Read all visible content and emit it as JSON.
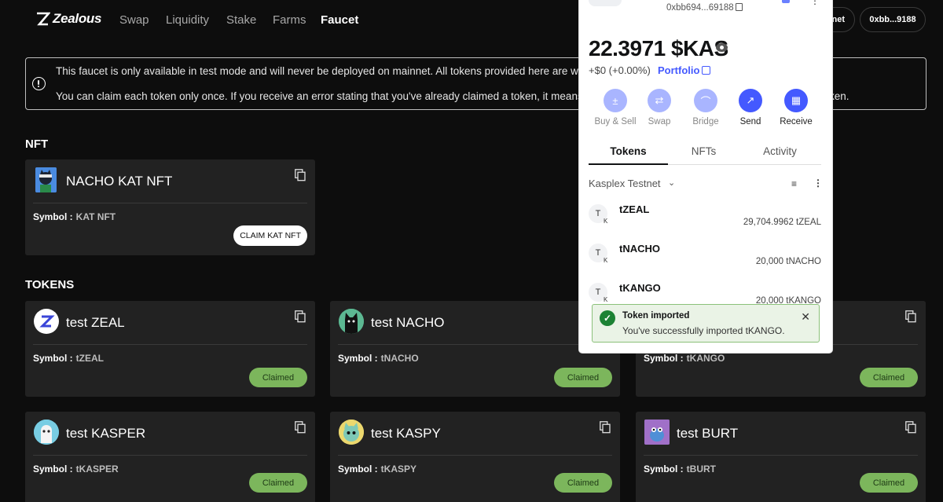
{
  "nav": {
    "brand": "Zealous",
    "links": [
      "Swap",
      "Liquidity",
      "Stake",
      "Farms",
      "Faucet"
    ],
    "active": "Faucet",
    "network_pill": "net",
    "account_pill": "0xbb...9188"
  },
  "banner": {
    "line1": "This faucet is only available in test mode and will never be deployed on mainnet. All tokens provided here are worthle",
    "line2_left": "You can claim each token only once. If you receive an error stating that you've already claimed a token, it means you",
    "line2_right": "ken."
  },
  "nft_section": {
    "title": "NFT",
    "card": {
      "name": "NACHO KAT NFT",
      "symbol_label": "Symbol :",
      "symbol": "KAT NFT",
      "button": "CLAIM KAT NFT"
    }
  },
  "tokens_section": {
    "title": "TOKENS",
    "symbol_label": "Symbol :",
    "cards": [
      {
        "name": "test ZEAL",
        "symbol": "tZEAL",
        "status": "Claimed"
      },
      {
        "name": "test NACHO",
        "symbol": "tNACHO",
        "status": "Claimed"
      },
      {
        "name": "",
        "symbol": "tKANGO",
        "status": "Claimed"
      },
      {
        "name": "test KASPER",
        "symbol": "tKASPER",
        "status": "Claimed"
      },
      {
        "name": "test KASPY",
        "symbol": "tKASPY",
        "status": "Claimed"
      },
      {
        "name": "test BURT",
        "symbol": "tBURT",
        "status": "Claimed"
      }
    ]
  },
  "wallet": {
    "address": "0xbb694...69188",
    "balance": "22.3971 $KAS",
    "change": "+$0 (+0.00%)",
    "portfolio_label": "Portfolio",
    "actions": [
      "Buy & Sell",
      "Swap",
      "Bridge",
      "Send",
      "Receive"
    ],
    "tabs": [
      "Tokens",
      "NFTs",
      "Activity"
    ],
    "network": "Kasplex Testnet",
    "tokens": [
      {
        "icon": "T",
        "network_badge": "K",
        "name": "tZEAL",
        "balance": "29,704.9962 tZEAL"
      },
      {
        "icon": "T",
        "network_badge": "K",
        "name": "tNACHO",
        "balance": "20,000 tNACHO"
      },
      {
        "icon": "T",
        "network_badge": "K",
        "name": "tKANGO",
        "balance": "20,000 tKANGO"
      }
    ],
    "toast": {
      "title": "Token imported",
      "message": "You've successfully imported tKANGO."
    }
  },
  "colors": {
    "background": "#0d0d0d",
    "card": "#222222",
    "claimed": "#7cb65c",
    "wallet_accent": "#4459ff",
    "toast_success": "#1c8234"
  }
}
